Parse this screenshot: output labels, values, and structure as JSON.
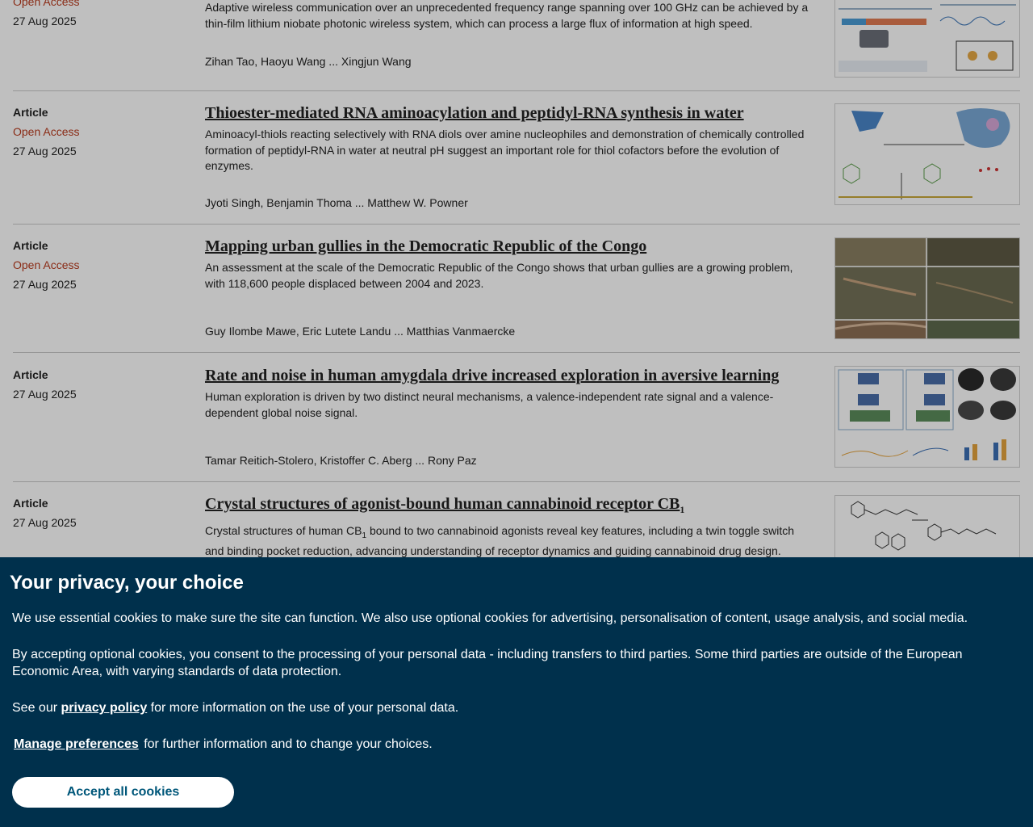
{
  "articles": [
    {
      "type": "",
      "open_access": "Open Access",
      "date": "27 Aug 2025",
      "title": "",
      "description": "Adaptive wireless communication over an unprecedented frequency range spanning over 100 GHz can be achieved by a thin-film lithium niobate photonic wireless system, which can process a large flux of information at high speed.",
      "authors": "Zihan Tao, Haoyu Wang ... Xingjun Wang",
      "thumb_icon": "photonic-system-diagram"
    },
    {
      "type": "Article",
      "open_access": "Open Access",
      "date": "27 Aug 2025",
      "title": "Thioester-mediated RNA aminoacylation and peptidyl-RNA synthesis in water",
      "description": "Aminoacyl-thiols reacting selectively with RNA diols over amine nucleophiles and demonstration of chemically controlled formation of peptidyl-RNA in water at neutral pH suggest an important role for thiol cofactors before the evolution of enzymes.",
      "authors": "Jyoti Singh, Benjamin Thoma ... Matthew W. Powner",
      "thumb_icon": "chemistry-diagram"
    },
    {
      "type": "Article",
      "open_access": "Open Access",
      "date": "27 Aug 2025",
      "title": "Mapping urban gullies in the Democratic Republic of the Congo",
      "description": "An assessment at the scale of the Democratic Republic of the Congo shows that urban gullies are a growing problem, with 118,600 people displaced between 2004 and 2023.",
      "authors": "Guy Ilombe Mawe, Eric Lutete Landu ... Matthias Vanmaercke",
      "thumb_icon": "satellite-imagery"
    },
    {
      "type": "Article",
      "open_access": "",
      "date": "27 Aug 2025",
      "title": "Rate and noise in human amygdala drive increased exploration in aversive learning",
      "description": "Human exploration is driven by two distinct neural mechanisms, a valence-independent rate signal and a valence-dependent global noise signal.",
      "authors": "Tamar Reitich-Stolero, Kristoffer C. Aberg ... Rony Paz",
      "thumb_icon": "neuroscience-figure"
    },
    {
      "type": "Article",
      "open_access": "",
      "date": "27 Aug 2025",
      "title_main": "Crystal structures of agonist-bound human cannabinoid receptor CB",
      "title_sub": "1",
      "description_pre": "Crystal structures of human CB",
      "description_sub": "1",
      "description_post": " bound to two cannabinoid agonists reveal key features, including a twin toggle switch and binding pocket reduction, advancing understanding of receptor dynamics and guiding cannabinoid drug design.",
      "thumb_icon": "molecular-structure"
    }
  ],
  "privacy": {
    "heading": "Your privacy, your choice",
    "para1": "We use essential cookies to make sure the site can function. We also use optional cookies for advertising, personalisation of content, usage analysis, and social media.",
    "para2": "By accepting optional cookies, you consent to the processing of your personal data - including transfers to third parties. Some third parties are outside of the European Economic Area, with varying standards of data protection.",
    "see_our": "See our",
    "privacy_link": "privacy policy",
    "see_rest": "for more information on the use of your personal data.",
    "manage_link": "Manage preferences",
    "manage_rest": "for further information and to change your choices.",
    "accept_button": "Accept all cookies"
  }
}
